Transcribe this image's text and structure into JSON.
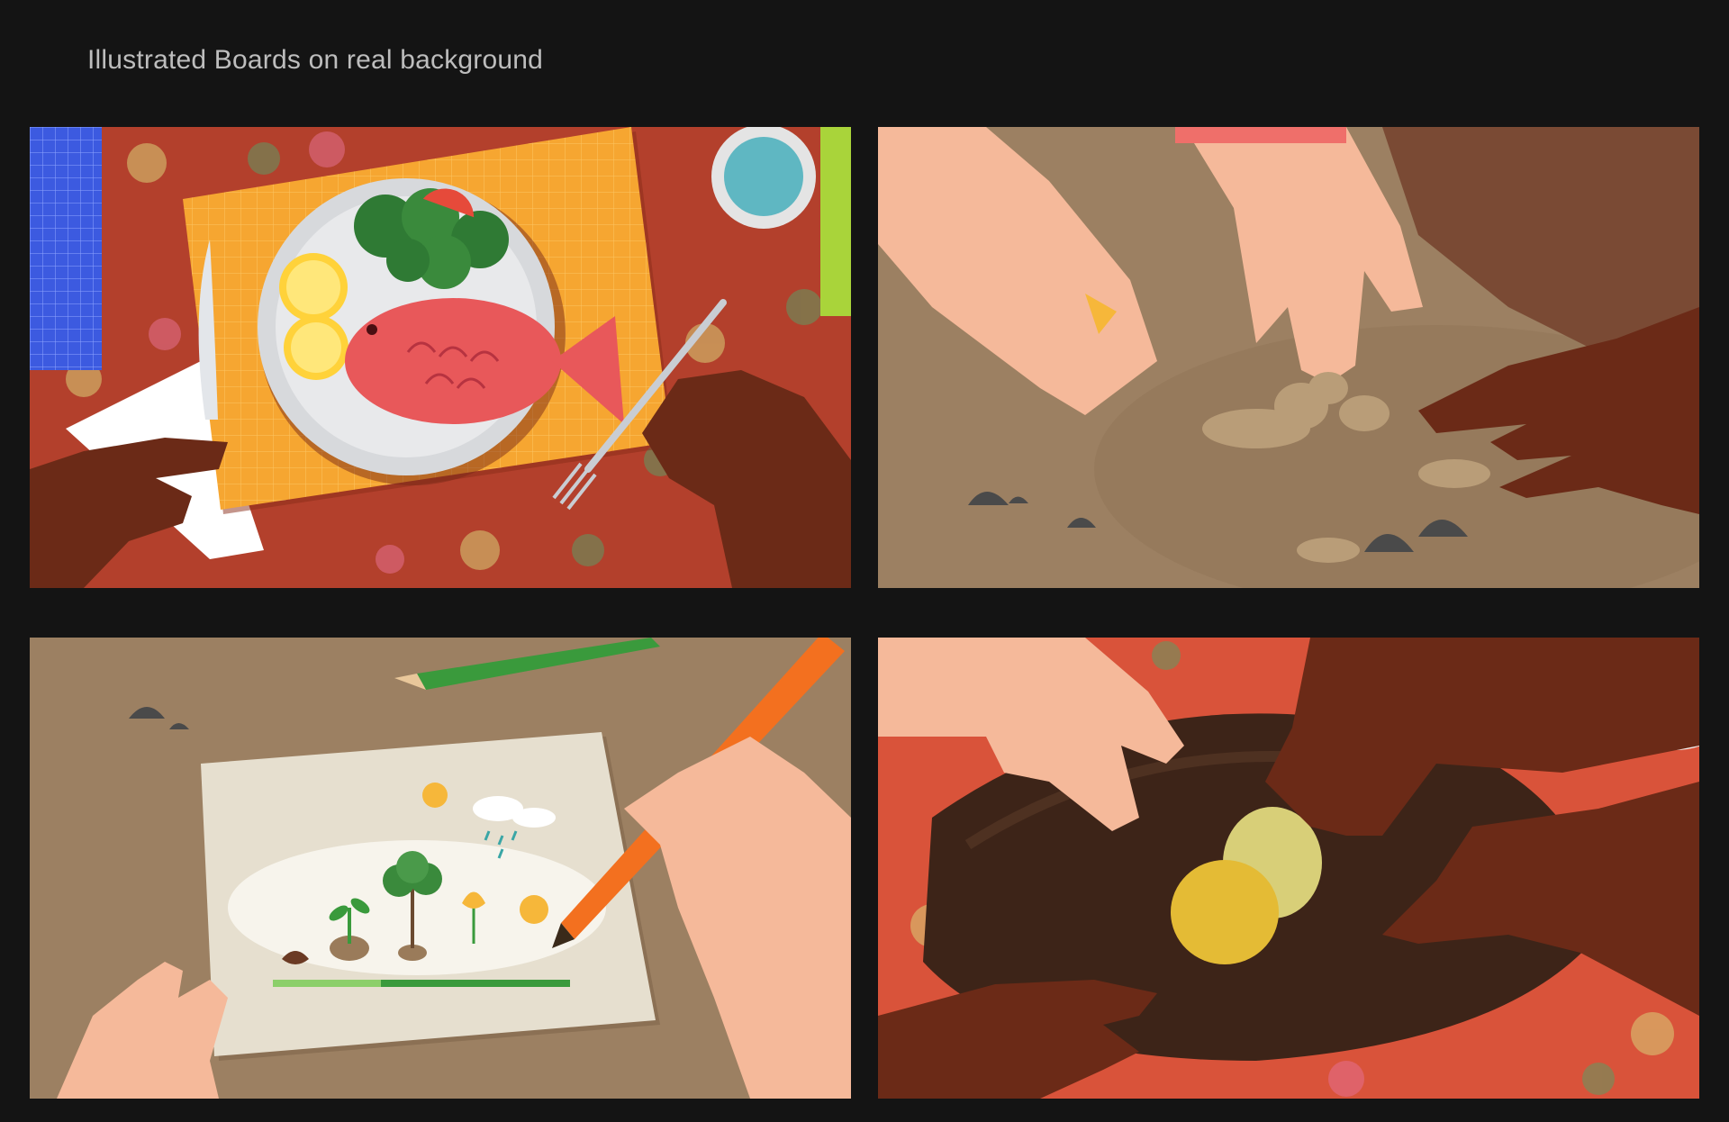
{
  "header": {
    "title": "Illustrated Boards on real background"
  },
  "boards": [
    {
      "scene": "meal-on-tablecloth",
      "illustrated_elements": [
        "plate",
        "fish",
        "lemon-slices",
        "salad",
        "knife",
        "fork",
        "cup",
        "placemat",
        "hands"
      ]
    },
    {
      "scene": "hands-digging-soil",
      "illustrated_elements": [
        "hands",
        "dust-clouds",
        "stones"
      ]
    },
    {
      "scene": "drawing-plant-life-cycle",
      "illustrated_elements": [
        "paper",
        "seed",
        "sprout",
        "tree",
        "flower",
        "fruit",
        "sun",
        "rain-cloud",
        "pencils",
        "hands"
      ]
    },
    {
      "scene": "hands-reaching-fruit-in-bowl",
      "illustrated_elements": [
        "wooden-bowl",
        "fruits",
        "hands"
      ]
    }
  ],
  "colors": {
    "background": "#141414",
    "title_text": "#bdbdbd",
    "skin_light": "#f5b99a",
    "skin_dark": "#6b2a17",
    "fish": "#e8585a",
    "placemat": "#f6a631",
    "sand": "#9c8062",
    "tablecloth": "#b3402c"
  }
}
